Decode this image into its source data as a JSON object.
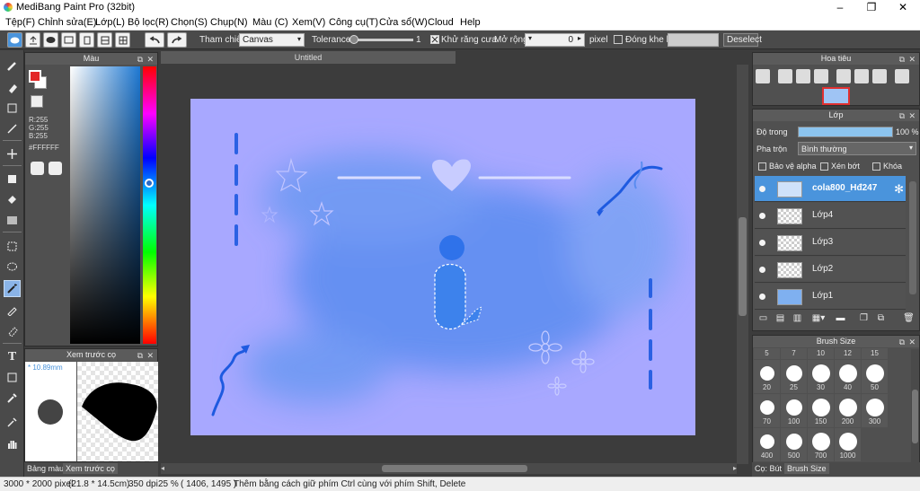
{
  "window": {
    "title": "MediBang Paint Pro (32bit)"
  },
  "menu": [
    "Tệp(F)",
    "Chỉnh sửa(E)",
    "Lớp(L)",
    "Bộ lọc(R)",
    "Chọn(S)",
    "Chụp(N)",
    "Màu (C)",
    "Xem(V)",
    "Công cụ(T)",
    "Cửa sổ(W)",
    "Cloud",
    "Help"
  ],
  "toolbar": {
    "ref_label": "Tham chiếu",
    "ref_value": "Canvas",
    "tolerance_label": "Tolerance",
    "tolerance_value": "1",
    "tolerance_level": 0.02,
    "antialias_label": "Khử răng cưa",
    "antialias_checked": true,
    "expand_label": "Mở rộng",
    "expand_value": "0",
    "expand_unit": "pixel",
    "close_gap_label": "Đóng khe hở",
    "close_gap_checked": false,
    "deselect_label": "Deselect"
  },
  "color_panel": {
    "title": "Màu",
    "r": "R:255",
    "g": "G:255",
    "b": "B:255",
    "hex": "#FFFFFF",
    "fg_color": "#e32626",
    "bg_color": "#ffffff"
  },
  "preview_panel": {
    "title": "Xem trước cọ",
    "size": "* 10.89mm"
  },
  "left_tabs": [
    "Bảng màu",
    "Xem trước cọ"
  ],
  "document": {
    "tab": "Untitled"
  },
  "status": {
    "size": "3000 * 2000 pixel",
    "cm": "(21.8 * 14.5cm)",
    "dpi": "350 dpi",
    "zoom": "25 %",
    "coords": "( 1406, 1495 )",
    "hint": "Thêm bằng cách giữ phím Ctrl cùng với phím Shift, Delete"
  },
  "navigator": {
    "title": "Hoa tiêu"
  },
  "layer_panel": {
    "title": "Lớp",
    "opacity_label": "Độ trong",
    "opacity_value": "100 %",
    "opacity_level": 1.0,
    "blend_label": "Pha trộn",
    "blend_value": "Bình thường",
    "protect_alpha": "Bảo vệ alpha",
    "clipping": "Xén bớt",
    "lock": "Khóa",
    "layers": [
      {
        "name": "cola800_Hđ247",
        "active": true
      },
      {
        "name": "Lớp4",
        "active": false
      },
      {
        "name": "Lớp3",
        "active": false
      },
      {
        "name": "Lớp2",
        "active": false
      },
      {
        "name": "Lớp1",
        "active": false
      }
    ]
  },
  "brush_size_panel": {
    "title": "Brush Size",
    "header_sizes": [
      "5",
      "7",
      "10",
      "12",
      "15"
    ],
    "sizes": [
      "20",
      "25",
      "30",
      "40",
      "50",
      "70",
      "100",
      "150",
      "200",
      "300",
      "400",
      "500",
      "700",
      "1000"
    ]
  },
  "right_tabs": [
    "Cọ: Bút",
    "Brush Size"
  ],
  "colors": {
    "canvas_bg": "#a8a8ff",
    "accent": "#4a94dc",
    "cloud": "#5a8cf0",
    "stroke": "#1e5ae0"
  }
}
